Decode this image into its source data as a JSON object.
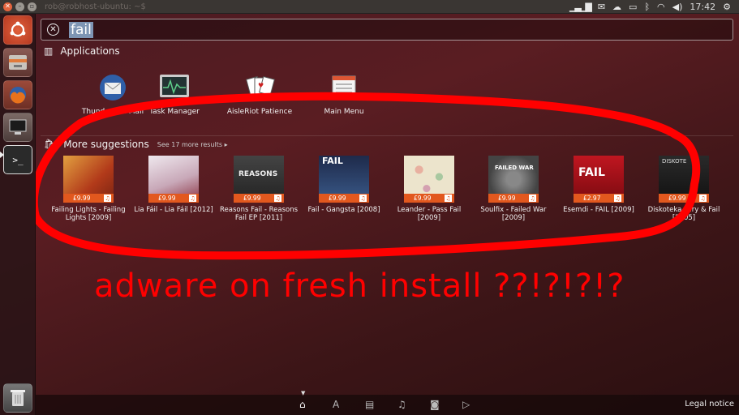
{
  "panel": {
    "window_title": "rob@robhost-ubuntu: ~$",
    "clock": "17:42",
    "indicators": [
      "network-graph-icon",
      "mail-icon",
      "cloud-icon",
      "battery-icon",
      "bluetooth-icon",
      "wifi-icon",
      "volume-icon",
      "gear-icon"
    ]
  },
  "launcher": {
    "items": [
      "ubuntu-dash-icon",
      "files-icon",
      "firefox-icon",
      "system-settings-icon",
      "terminal-icon"
    ],
    "trash": "trash-icon"
  },
  "search": {
    "query": "fail"
  },
  "applications": {
    "header": "Applications",
    "items": [
      {
        "label": "Thunderbird Mail",
        "icon": "thunderbird-icon"
      },
      {
        "label": "Task Manager",
        "icon": "task-manager-icon"
      },
      {
        "label": "AisleRiot Patience",
        "icon": "cards-icon"
      },
      {
        "label": "Main Menu",
        "icon": "main-menu-icon"
      }
    ]
  },
  "suggestions": {
    "header": "More suggestions",
    "see_more": "See 17 more results",
    "items": [
      {
        "title": "Failing Lights - Failing Lights [2009]",
        "price": "£9.99",
        "color": "#c24a1a"
      },
      {
        "title": "Lia Fáil - Lia Fáil [2012]",
        "price": "£9.99",
        "color": "#d8c6cf"
      },
      {
        "title": "Reasons Fail - Reasons Fail EP [2011]",
        "price": "£9.99",
        "color": "#3a3a3a"
      },
      {
        "title": "Fail - Gangsta [2008]",
        "price": "£9.99",
        "color": "#2e3f66"
      },
      {
        "title": "Leander - Pass Fail [2009]",
        "price": "£9.99",
        "color": "#e9e2cc"
      },
      {
        "title": "Soulfix - Failed War [2009]",
        "price": "£9.99",
        "color": "#6a6a6a"
      },
      {
        "title": "Esemdi - FAIL [2009]",
        "price": "£2.97",
        "color": "#b3111b"
      },
      {
        "title": "Diskoteka - Try & Fail [2005]",
        "price": "£9.99",
        "color": "#1c1c1c"
      }
    ],
    "cover_text": {
      "reasons": "REASONS",
      "fail": "FAIL",
      "esemdi": "FAIL",
      "soulfix": "FAILED WAR",
      "diskoteka": "DISKOTE"
    }
  },
  "annotation": "adware on fresh install ??!?!?!?",
  "lens_bar": {
    "lenses": [
      "home-lens-icon",
      "applications-lens-icon",
      "files-lens-icon",
      "music-lens-icon",
      "photos-lens-icon",
      "video-lens-icon"
    ],
    "legal": "Legal notice"
  }
}
